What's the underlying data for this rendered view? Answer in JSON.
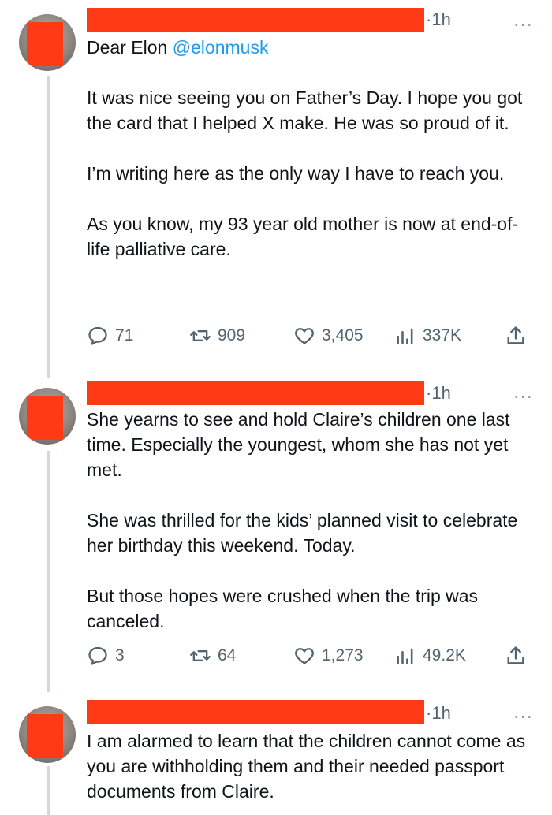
{
  "tweets": [
    {
      "time": "1h",
      "greeting": "Dear Elon ",
      "mention": "@elonmusk",
      "paragraphs": [
        "It was nice seeing you on Father’s Day. I hope you got the card that I helped X make. He was so proud of it.",
        "I’m writing here as the only way I have to reach you.",
        "As you know, my 93 year old mother is now at end-of-life palliative care."
      ],
      "replies": "71",
      "reposts": "909",
      "likes": "3,405",
      "views": "337K"
    },
    {
      "time": "1h",
      "paragraphs": [
        "She yearns to see and hold Claire’s children one last time. Especially the youngest, whom she has not yet met.",
        "She was thrilled for the kids’ planned visit to celebrate her birthday this weekend. Today.",
        "But those hopes were crushed when the trip was canceled."
      ],
      "replies": "3",
      "reposts": "64",
      "likes": "1,273",
      "views": "49.2K"
    },
    {
      "time": "1h",
      "paragraphs": [
        "I am alarmed to learn that the children cannot come as you are withholding them and their needed passport documents from Claire."
      ]
    }
  ],
  "more_label": "···",
  "time_separator": "·",
  "colors": {
    "redaction": "#ff3a14",
    "mention": "#1d9bf0",
    "muted": "#536471",
    "thread_line": "#cfd9de"
  }
}
